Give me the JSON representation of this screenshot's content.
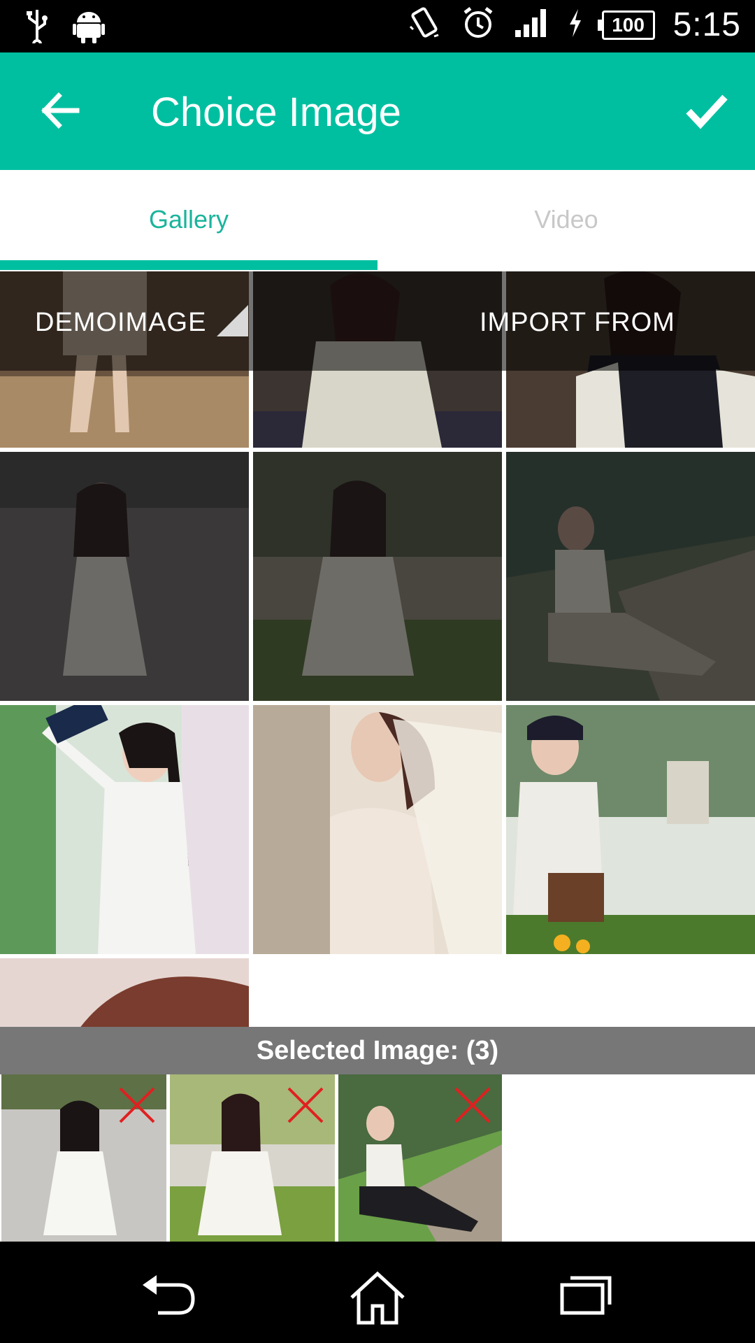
{
  "status_bar": {
    "time": "5:15",
    "battery": "100"
  },
  "app_bar": {
    "title": "Choice Image"
  },
  "tabs": [
    {
      "label": "Gallery",
      "active": true
    },
    {
      "label": "Video",
      "active": false
    }
  ],
  "folder_bar": {
    "left_label": "DEMOIMAGE",
    "right_label": "IMPORT FROM"
  },
  "selected": {
    "label": "Selected Image: (3)"
  },
  "colors": {
    "accent": "#00bfa0",
    "tab_active": "#1ab49c",
    "tab_inactive": "#c8c8c8"
  },
  "icons": [
    "usb-icon",
    "android-icon",
    "vibrate-icon",
    "alarm-icon",
    "signal-icon",
    "charging-icon",
    "battery-icon",
    "back-arrow-icon",
    "checkmark-icon",
    "remove-x-icon",
    "nav-back-icon",
    "nav-home-icon",
    "nav-recents-icon"
  ]
}
